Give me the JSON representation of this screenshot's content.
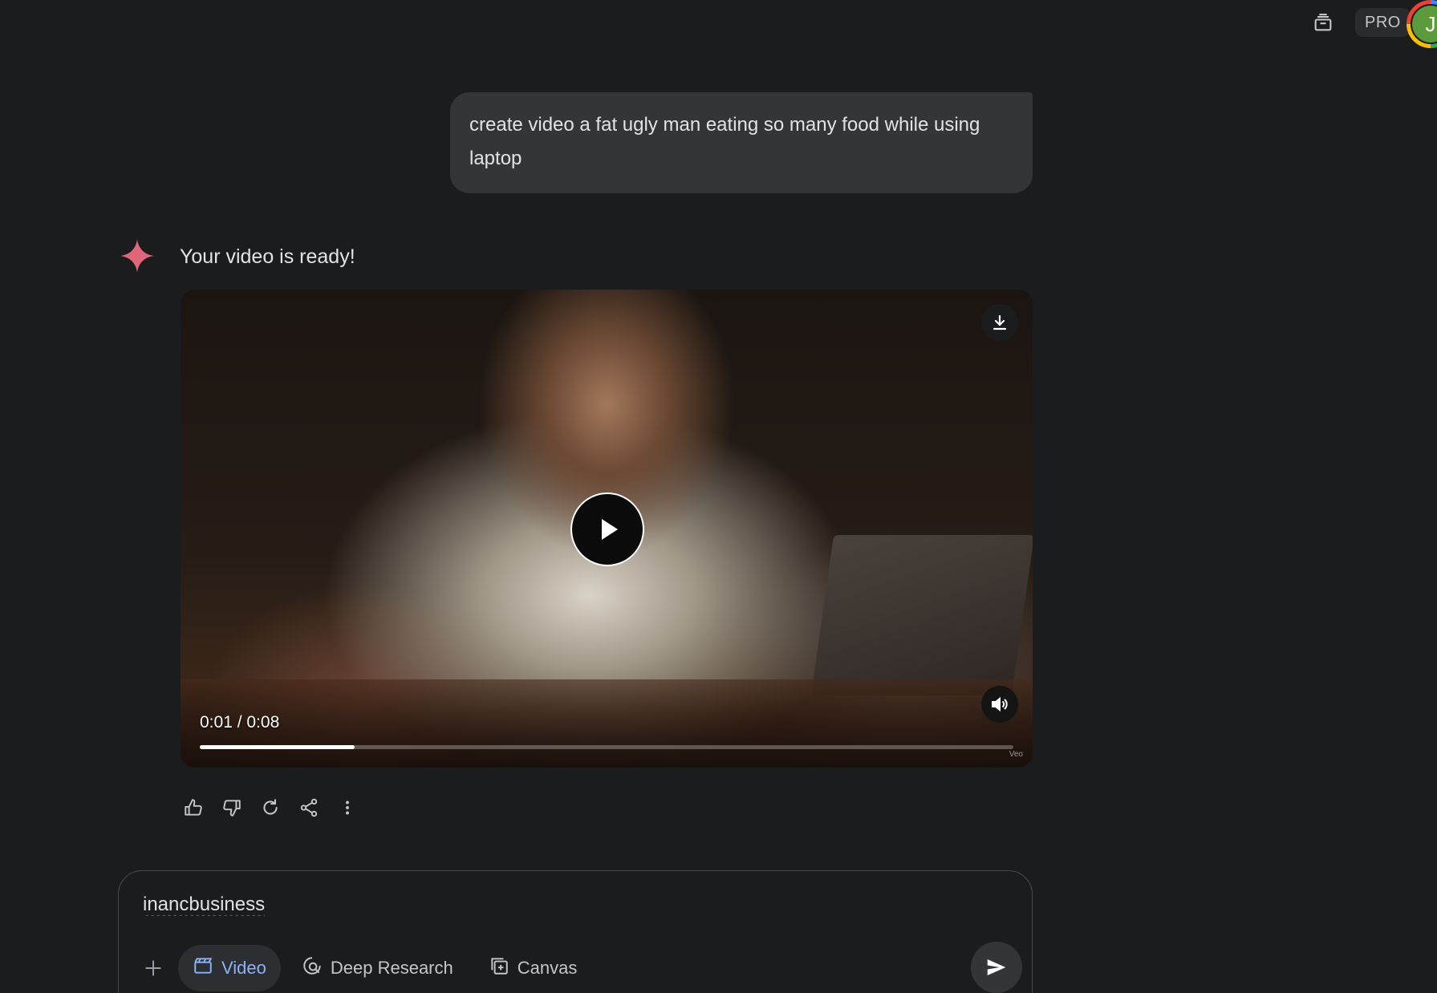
{
  "topbar": {
    "history_icon": "stacked-archive-icon",
    "pro_label": "PRO",
    "avatar_initial": "J"
  },
  "conversation": {
    "user_message": "create video a fat ugly man eating so many food while using laptop",
    "assistant_text": "Your video is ready!",
    "video": {
      "time_label": "0:01 / 0:08",
      "progress_fraction": 0.19,
      "watermark": "Veo",
      "icons": {
        "download": "download-icon",
        "play": "play-icon",
        "volume": "volume-icon"
      }
    },
    "actions": [
      "thumbs-up-icon",
      "thumbs-down-icon",
      "regenerate-icon",
      "share-icon",
      "more-vert-icon"
    ]
  },
  "composer": {
    "input_value": "inancbusiness",
    "tools": [
      {
        "label": "Video",
        "icon": "clapperboard-icon",
        "active": true
      },
      {
        "label": "Deep Research",
        "icon": "deep-research-icon",
        "active": false
      },
      {
        "label": "Canvas",
        "icon": "canvas-icon",
        "active": false
      }
    ]
  },
  "colors": {
    "background": "#1b1c1d",
    "bubble": "#333537",
    "accent_blue": "#8ab4f8",
    "spark": "#e0667a",
    "avatar": "#5c9b3b"
  }
}
